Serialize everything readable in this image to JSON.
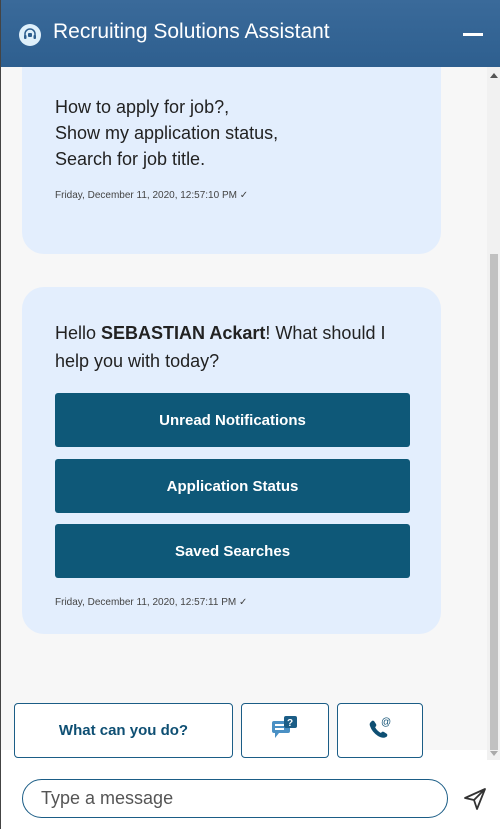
{
  "header": {
    "title": "Recruiting Solutions Assistant",
    "icons": {
      "logo": "headset-chat-icon",
      "minimize": "minimize-icon"
    }
  },
  "messages": [
    {
      "lines": [
        "How to apply for job?,",
        "Show my application status,",
        "Search for job title."
      ],
      "timestamp": "Friday, December 11, 2020, 12:57:10 PM ✓"
    },
    {
      "greeting_prefix": "Hello ",
      "greeting_name": "SEBASTIAN Ackart",
      "greeting_suffix": "! What should I help you with today?",
      "buttons": [
        "Unread Notifications",
        "Application Status",
        "Saved Searches"
      ],
      "timestamp": "Friday, December 11, 2020, 12:57:11 PM ✓"
    }
  ],
  "quick_actions": {
    "what_can_you_do": "What can you do?",
    "icons": {
      "help": "help-chat-icon",
      "contact": "phone-email-icon"
    }
  },
  "composer": {
    "placeholder": "Type a message",
    "value": "",
    "send_icon": "send-icon"
  },
  "colors": {
    "header": "#2e5f8f",
    "bubble": "#e3eefd",
    "button": "#0e5878",
    "outline": "#1b5d86"
  }
}
